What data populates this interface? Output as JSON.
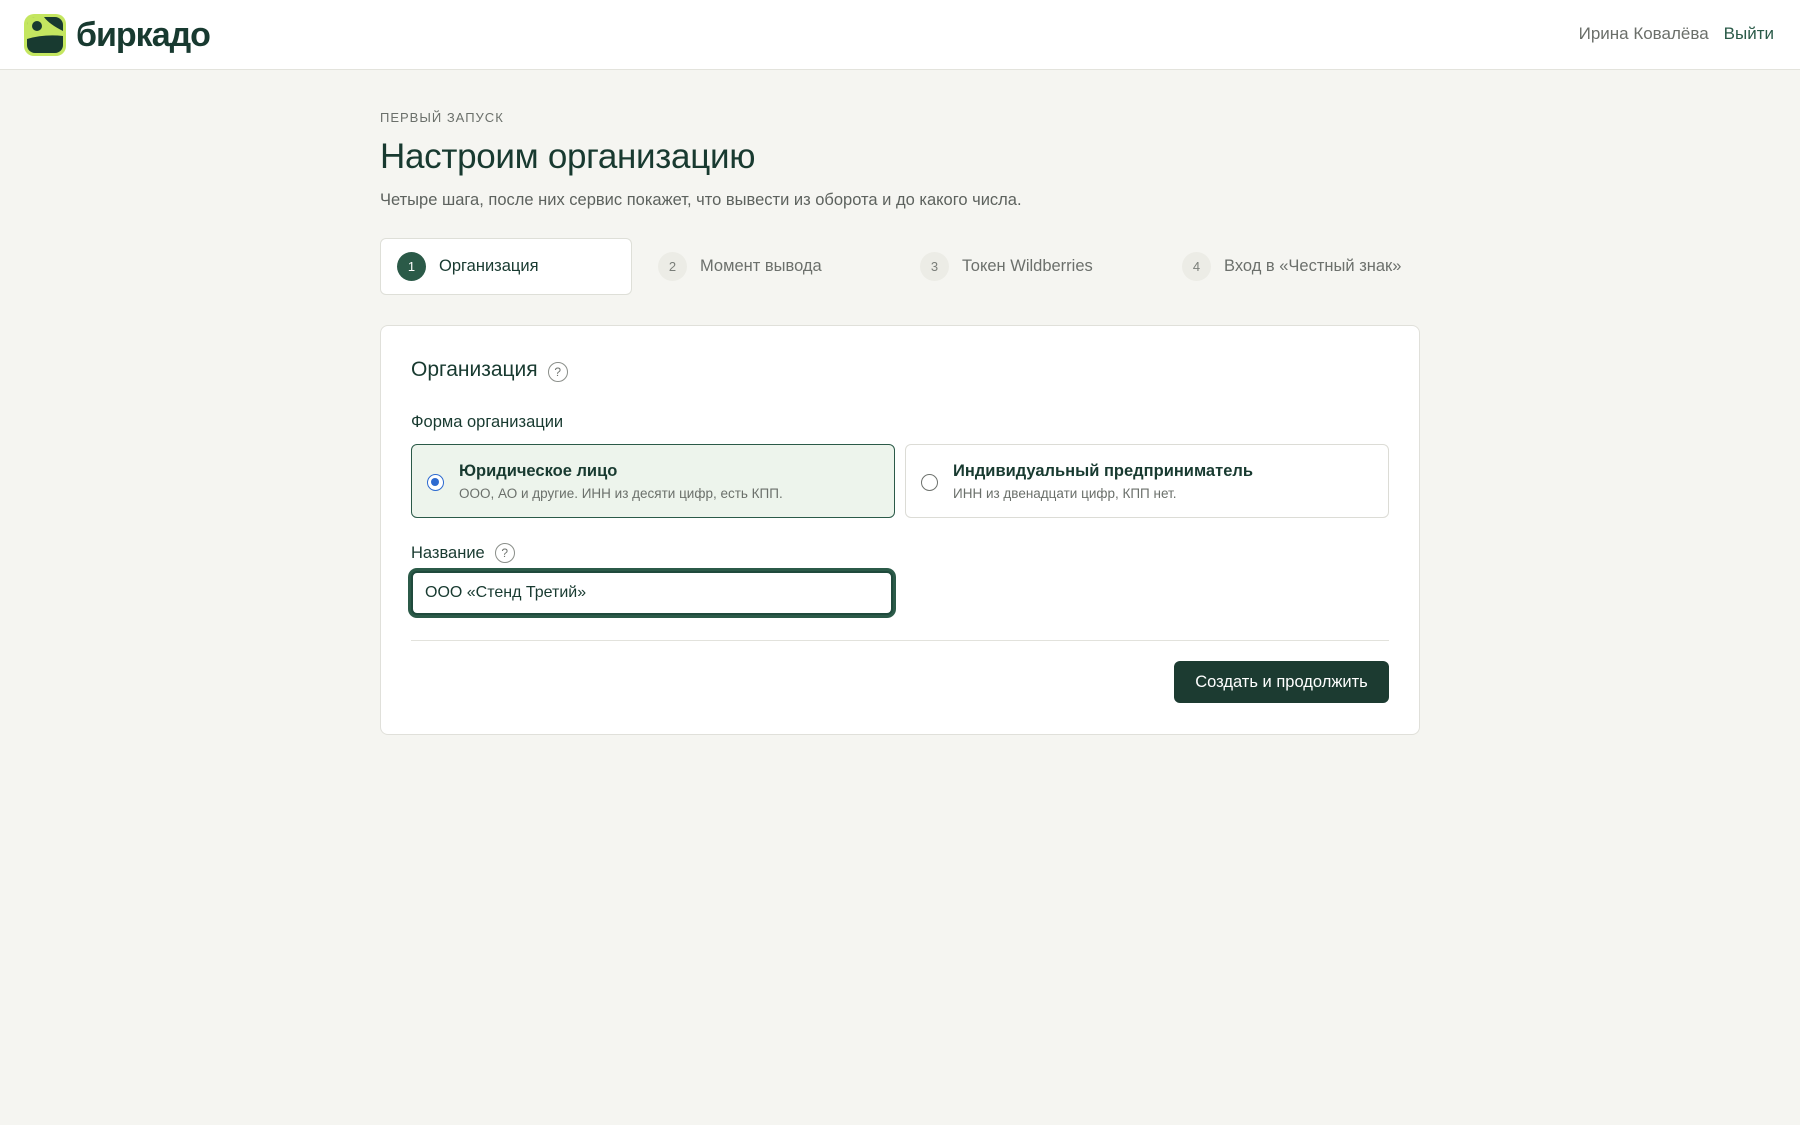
{
  "header": {
    "logo_text": "биркадо",
    "user_name": "Ирина Ковалёва",
    "logout_label": "Выйти"
  },
  "page": {
    "eyebrow": "ПЕРВЫЙ ЗАПУСК",
    "title": "Настроим организацию",
    "subtitle": "Четыре шага, после них сервис покажет, что вывести из оборота и до какого числа."
  },
  "steps": [
    {
      "number": "1",
      "label": "Организация",
      "active": true
    },
    {
      "number": "2",
      "label": "Момент вывода",
      "active": false
    },
    {
      "number": "3",
      "label": "Токен Wildberries",
      "active": false
    },
    {
      "number": "4",
      "label": "Вход в «Честный знак»",
      "active": false
    }
  ],
  "card": {
    "title": "Организация",
    "help_glyph": "?",
    "form_label": "Форма организации",
    "options": [
      {
        "title": "Юридическое лицо",
        "description": "ООО, АО и другие. ИНН из десяти цифр, есть КПП.",
        "selected": true
      },
      {
        "title": "Индивидуальный предприниматель",
        "description": "ИНН из двенадцати цифр, КПП нет.",
        "selected": false
      }
    ],
    "name_label": "Название",
    "name_value": "ООО «Стенд Третий»",
    "submit_label": "Создать и продолжить"
  },
  "colors": {
    "background": "#f5f5f1",
    "primary_dark": "#1c3b31",
    "accent_green": "#2b5a48",
    "selected_option_bg": "#edf4ec",
    "logo_lime": "#c4e660",
    "radio_blue": "#2d6ad0"
  }
}
